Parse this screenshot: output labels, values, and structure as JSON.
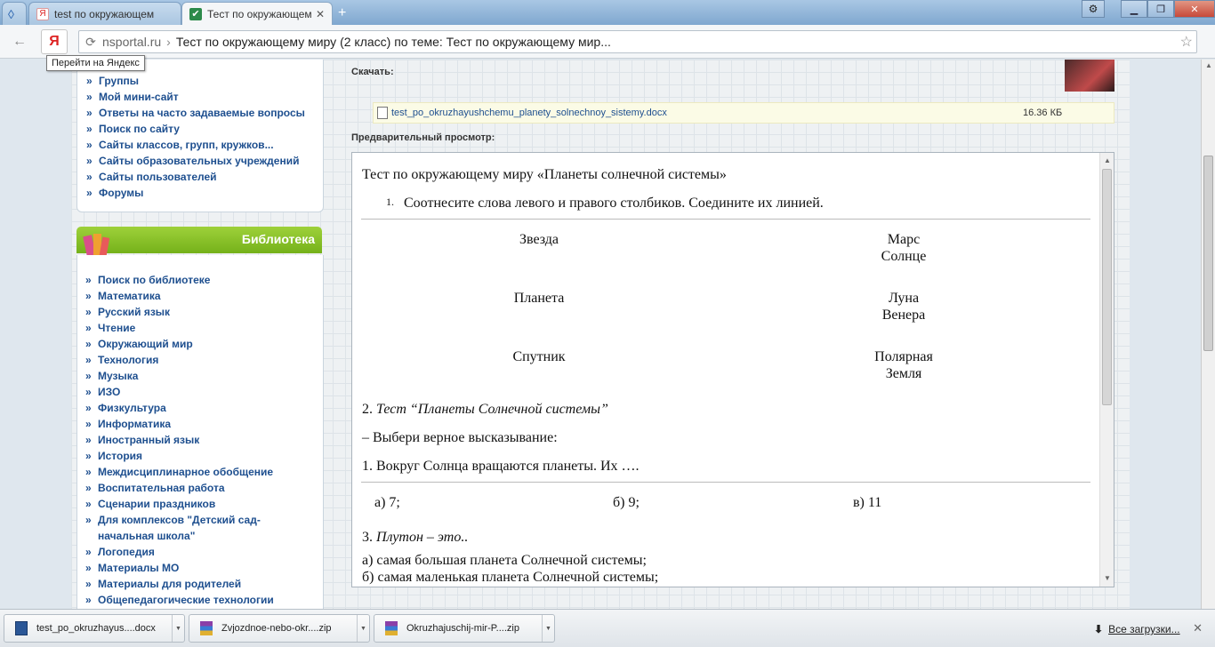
{
  "tabs": [
    {
      "title": "",
      "type": "pinned"
    },
    {
      "title": "test по окружающем",
      "active": false
    },
    {
      "title": "Тест по окружающем",
      "active": true
    }
  ],
  "toolbar": {
    "host": "nsportal.ru",
    "separator": "›",
    "page_title": "Тест по окружающему миру (2 класс) по теме: Тест по окружающему мир...",
    "yandex_glyph": "Я",
    "tooltip": "Перейти на Яндекс"
  },
  "sidebar": {
    "top_links": [
      "Группы",
      "Мой мини-сайт",
      "Ответы на часто задаваемые вопросы",
      "Поиск по сайту",
      "Сайты классов, групп, кружков...",
      "Сайты образовательных учреждений",
      "Сайты пользователей",
      "Форумы"
    ],
    "library": {
      "title": "Библиотека",
      "links": [
        "Поиск по библиотеке",
        "Математика",
        "Русский язык",
        "Чтение",
        "Окружающий мир",
        "Технология",
        "Музыка",
        "ИЗО",
        "Физкультура",
        "Информатика",
        "Иностранный язык",
        "История",
        "Междисциплинарное обобщение",
        "Воспитательная работа",
        "Сценарии праздников",
        "Для комплексов \"Детский сад-",
        "начальная школа\"",
        "Логопедия",
        "Материалы МО",
        "Материалы для родителей",
        "Общепедагогические технологии"
      ]
    }
  },
  "main": {
    "download_label": "Скачать:",
    "file": {
      "name": "test_po_okruzhayushchemu_planety_solnechnoy_sistemy.docx",
      "size": "16.36 КБ"
    },
    "preview_label": "Предварительный просмотр:",
    "doc": {
      "title": "Тест по окружающему миру «Планеты солнечной системы»",
      "q1_num": "1.",
      "q1": "Соотнесите слова левого и правого столбиков. Соедините их линией.",
      "left": [
        "Звезда",
        "Планета",
        "Спутник"
      ],
      "right": [
        [
          "Марс",
          "Солнце"
        ],
        [
          "Луна",
          "Венера"
        ],
        [
          "Полярная",
          "Земля"
        ]
      ],
      "s2_prefix": "2. ",
      "s2_title": "Тест  “Планеты Солнечной системы”",
      "instruction": "– Выбери верное высказывание:",
      "q_a": "1. Вокруг Солнца вращаются планеты. Их ….",
      "opts": [
        "а) 7;",
        "б) 9;",
        "в) 11"
      ],
      "q3_prefix": "3. ",
      "q3": "Плутон – это..",
      "q3_opts": [
        "а) самая большая планета Солнечной системы;",
        "б) самая маленькая планета Солнечной системы;"
      ]
    }
  },
  "downloads": {
    "items": [
      "test_po_okruzhayus....docx",
      "Zvjozdnoe-nebo-okr....zip",
      "Okruzhajuschij-mir-P....zip"
    ],
    "all_label": "Все загрузки...",
    "close": "✕"
  }
}
